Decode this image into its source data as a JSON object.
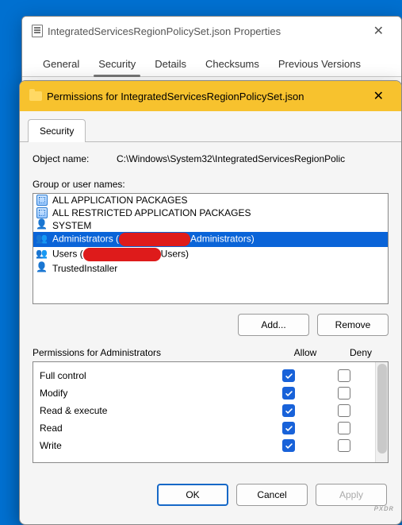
{
  "backWindow": {
    "title": "IntegratedServicesRegionPolicySet.json Properties",
    "tabs": [
      "General",
      "Security",
      "Details",
      "Checksums",
      "Previous Versions"
    ],
    "activeTab": 1
  },
  "frontWindow": {
    "title": "Permissions for IntegratedServicesRegionPolicySet.json",
    "securityTab": "Security",
    "objectNameLabel": "Object name:",
    "objectNameValue": "C:\\Windows\\System32\\IntegratedServicesRegionPolic",
    "groupLabel": "Group or user names:",
    "groups": [
      {
        "icon": "pkg",
        "text": "ALL APPLICATION PACKAGES"
      },
      {
        "icon": "pkg",
        "text": "ALL RESTRICTED APPLICATION PACKAGES"
      },
      {
        "icon": "user",
        "text": "SYSTEM"
      },
      {
        "icon": "users",
        "pre": "Administrators (",
        "post": "Administrators)",
        "redacted": true,
        "rclass": "r1",
        "selected": true
      },
      {
        "icon": "users",
        "pre": "Users (",
        "post": "Users)",
        "redacted": true,
        "rclass": "r2"
      },
      {
        "icon": "user",
        "text": "TrustedInstaller"
      }
    ],
    "addBtn": "Add...",
    "removeBtn": "Remove",
    "permHeaderLabel": "Permissions for Administrators",
    "allowLabel": "Allow",
    "denyLabel": "Deny",
    "permissions": [
      {
        "name": "Full control",
        "allow": true,
        "deny": false
      },
      {
        "name": "Modify",
        "allow": true,
        "deny": false
      },
      {
        "name": "Read & execute",
        "allow": true,
        "deny": false
      },
      {
        "name": "Read",
        "allow": true,
        "deny": false
      },
      {
        "name": "Write",
        "allow": true,
        "deny": false
      }
    ],
    "okBtn": "OK",
    "cancelBtn": "Cancel",
    "applyBtn": "Apply"
  },
  "watermark": "ᴘxᴅʀ"
}
